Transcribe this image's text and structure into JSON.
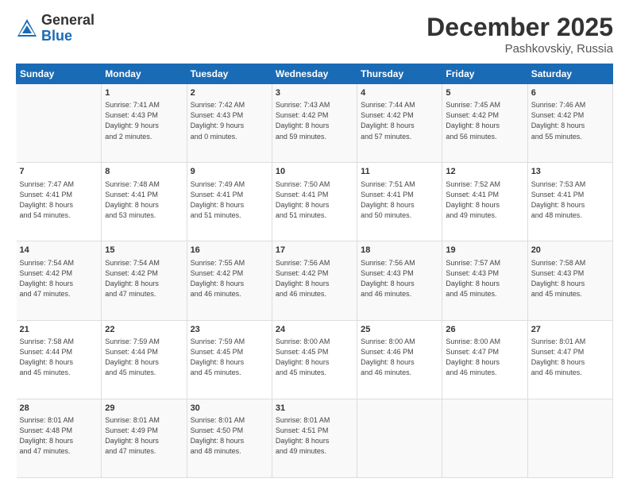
{
  "header": {
    "logo": {
      "general": "General",
      "blue": "Blue"
    },
    "title": "December 2025",
    "location": "Pashkovskiy, Russia"
  },
  "days_of_week": [
    "Sunday",
    "Monday",
    "Tuesday",
    "Wednesday",
    "Thursday",
    "Friday",
    "Saturday"
  ],
  "weeks": [
    [
      {
        "day": "",
        "info": ""
      },
      {
        "day": "1",
        "info": "Sunrise: 7:41 AM\nSunset: 4:43 PM\nDaylight: 9 hours\nand 2 minutes."
      },
      {
        "day": "2",
        "info": "Sunrise: 7:42 AM\nSunset: 4:43 PM\nDaylight: 9 hours\nand 0 minutes."
      },
      {
        "day": "3",
        "info": "Sunrise: 7:43 AM\nSunset: 4:42 PM\nDaylight: 8 hours\nand 59 minutes."
      },
      {
        "day": "4",
        "info": "Sunrise: 7:44 AM\nSunset: 4:42 PM\nDaylight: 8 hours\nand 57 minutes."
      },
      {
        "day": "5",
        "info": "Sunrise: 7:45 AM\nSunset: 4:42 PM\nDaylight: 8 hours\nand 56 minutes."
      },
      {
        "day": "6",
        "info": "Sunrise: 7:46 AM\nSunset: 4:42 PM\nDaylight: 8 hours\nand 55 minutes."
      }
    ],
    [
      {
        "day": "7",
        "info": "Sunrise: 7:47 AM\nSunset: 4:41 PM\nDaylight: 8 hours\nand 54 minutes."
      },
      {
        "day": "8",
        "info": "Sunrise: 7:48 AM\nSunset: 4:41 PM\nDaylight: 8 hours\nand 53 minutes."
      },
      {
        "day": "9",
        "info": "Sunrise: 7:49 AM\nSunset: 4:41 PM\nDaylight: 8 hours\nand 51 minutes."
      },
      {
        "day": "10",
        "info": "Sunrise: 7:50 AM\nSunset: 4:41 PM\nDaylight: 8 hours\nand 51 minutes."
      },
      {
        "day": "11",
        "info": "Sunrise: 7:51 AM\nSunset: 4:41 PM\nDaylight: 8 hours\nand 50 minutes."
      },
      {
        "day": "12",
        "info": "Sunrise: 7:52 AM\nSunset: 4:41 PM\nDaylight: 8 hours\nand 49 minutes."
      },
      {
        "day": "13",
        "info": "Sunrise: 7:53 AM\nSunset: 4:41 PM\nDaylight: 8 hours\nand 48 minutes."
      }
    ],
    [
      {
        "day": "14",
        "info": "Sunrise: 7:54 AM\nSunset: 4:42 PM\nDaylight: 8 hours\nand 47 minutes."
      },
      {
        "day": "15",
        "info": "Sunrise: 7:54 AM\nSunset: 4:42 PM\nDaylight: 8 hours\nand 47 minutes."
      },
      {
        "day": "16",
        "info": "Sunrise: 7:55 AM\nSunset: 4:42 PM\nDaylight: 8 hours\nand 46 minutes."
      },
      {
        "day": "17",
        "info": "Sunrise: 7:56 AM\nSunset: 4:42 PM\nDaylight: 8 hours\nand 46 minutes."
      },
      {
        "day": "18",
        "info": "Sunrise: 7:56 AM\nSunset: 4:43 PM\nDaylight: 8 hours\nand 46 minutes."
      },
      {
        "day": "19",
        "info": "Sunrise: 7:57 AM\nSunset: 4:43 PM\nDaylight: 8 hours\nand 45 minutes."
      },
      {
        "day": "20",
        "info": "Sunrise: 7:58 AM\nSunset: 4:43 PM\nDaylight: 8 hours\nand 45 minutes."
      }
    ],
    [
      {
        "day": "21",
        "info": "Sunrise: 7:58 AM\nSunset: 4:44 PM\nDaylight: 8 hours\nand 45 minutes."
      },
      {
        "day": "22",
        "info": "Sunrise: 7:59 AM\nSunset: 4:44 PM\nDaylight: 8 hours\nand 45 minutes."
      },
      {
        "day": "23",
        "info": "Sunrise: 7:59 AM\nSunset: 4:45 PM\nDaylight: 8 hours\nand 45 minutes."
      },
      {
        "day": "24",
        "info": "Sunrise: 8:00 AM\nSunset: 4:45 PM\nDaylight: 8 hours\nand 45 minutes."
      },
      {
        "day": "25",
        "info": "Sunrise: 8:00 AM\nSunset: 4:46 PM\nDaylight: 8 hours\nand 46 minutes."
      },
      {
        "day": "26",
        "info": "Sunrise: 8:00 AM\nSunset: 4:47 PM\nDaylight: 8 hours\nand 46 minutes."
      },
      {
        "day": "27",
        "info": "Sunrise: 8:01 AM\nSunset: 4:47 PM\nDaylight: 8 hours\nand 46 minutes."
      }
    ],
    [
      {
        "day": "28",
        "info": "Sunrise: 8:01 AM\nSunset: 4:48 PM\nDaylight: 8 hours\nand 47 minutes."
      },
      {
        "day": "29",
        "info": "Sunrise: 8:01 AM\nSunset: 4:49 PM\nDaylight: 8 hours\nand 47 minutes."
      },
      {
        "day": "30",
        "info": "Sunrise: 8:01 AM\nSunset: 4:50 PM\nDaylight: 8 hours\nand 48 minutes."
      },
      {
        "day": "31",
        "info": "Sunrise: 8:01 AM\nSunset: 4:51 PM\nDaylight: 8 hours\nand 49 minutes."
      },
      {
        "day": "",
        "info": ""
      },
      {
        "day": "",
        "info": ""
      },
      {
        "day": "",
        "info": ""
      }
    ]
  ]
}
